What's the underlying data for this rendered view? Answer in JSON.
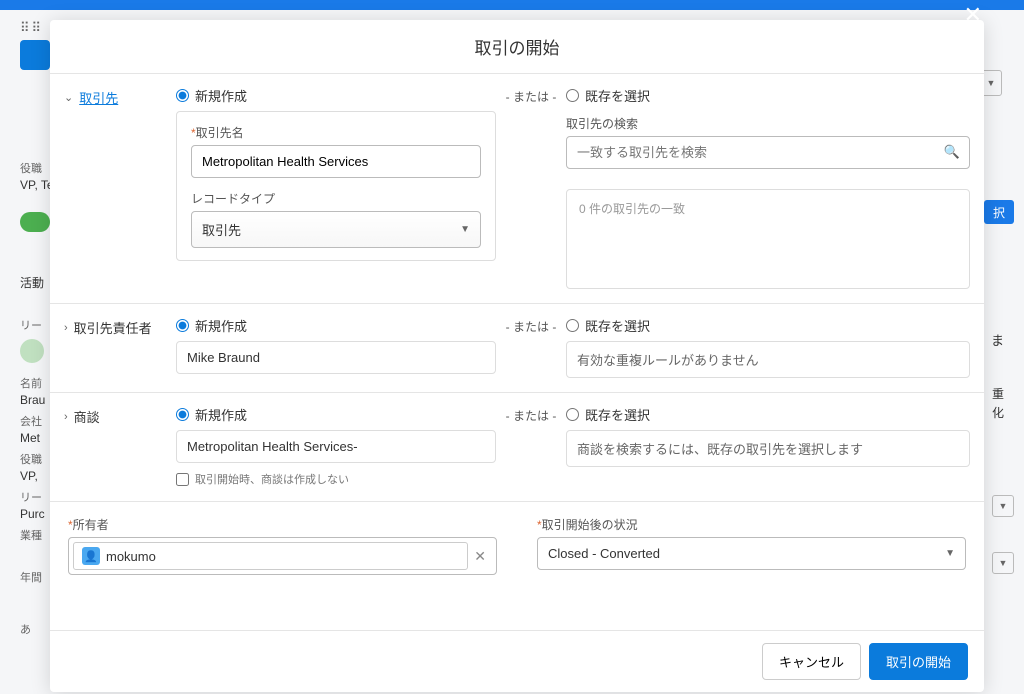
{
  "modal": {
    "title": "取引の開始",
    "or_label": "- または -"
  },
  "sections": {
    "account": {
      "label": "取引先",
      "create_new": "新規作成",
      "select_existing": "既存を選択",
      "name_label": "取引先名",
      "name_value": "Metropolitan Health Services",
      "record_type_label": "レコードタイプ",
      "record_type_value": "取引先",
      "search_label": "取引先の検索",
      "search_placeholder": "一致する取引先を検索",
      "result_text": "0 件の取引先の一致"
    },
    "contact": {
      "label": "取引先責任者",
      "create_new": "新規作成",
      "select_existing": "既存を選択",
      "name_value": "Mike Braund",
      "info_text": "有効な重複ルールがありません"
    },
    "opportunity": {
      "label": "商談",
      "create_new": "新規作成",
      "select_existing": "既存を選択",
      "name_value": "Metropolitan Health Services-",
      "info_text": "商談を検索するには、既存の取引先を選択します",
      "no_create_label": "取引開始時、商談は作成しない"
    }
  },
  "owner": {
    "label": "所有者",
    "value": "mokumo"
  },
  "status": {
    "label": "取引開始後の状況",
    "value": "Closed - Converted"
  },
  "footer": {
    "cancel": "キャンセル",
    "submit": "取引の開始"
  },
  "background": {
    "role_label": "役職",
    "role_value": "VP, Te",
    "activity": "活動",
    "lead": "リー",
    "name_label": "名前",
    "name_value": "Brau",
    "company_label": "会社",
    "company_value": "Met",
    "role2_label": "役職",
    "role2_value": "VP,",
    "lead2": "リー",
    "purc": "Purc",
    "industry": "業種",
    "year": "年間",
    "a": "あ",
    "ma": "ま",
    "ju": "重",
    "ka": "化",
    "ta": "択"
  }
}
